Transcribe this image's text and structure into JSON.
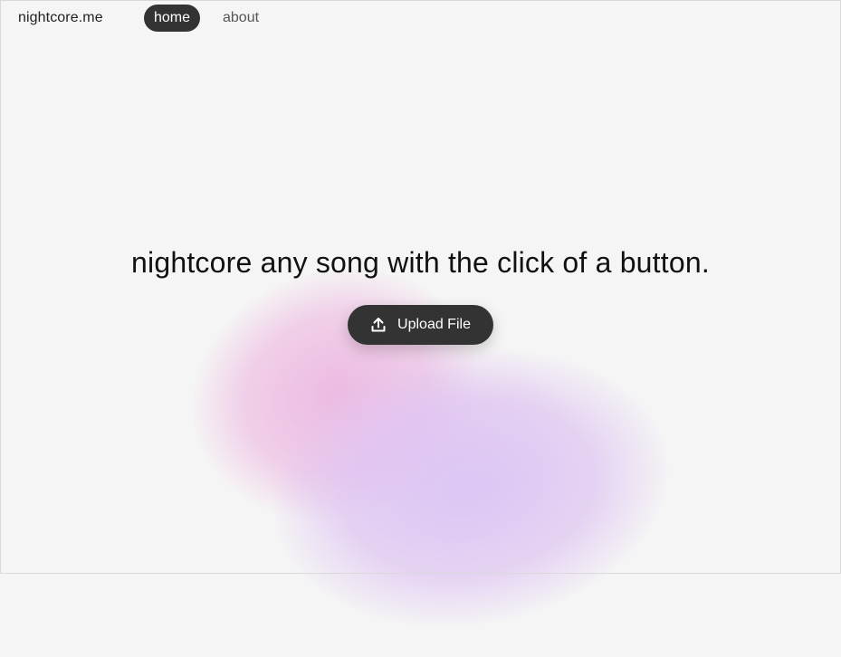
{
  "nav": {
    "brand": "nightcore.me",
    "items": [
      {
        "label": "home",
        "active": true
      },
      {
        "label": "about",
        "active": false
      }
    ]
  },
  "hero": {
    "headline": "nightcore any song with the click of a button.",
    "upload_button": {
      "label": "Upload File",
      "icon": "upload-icon"
    }
  },
  "colors": {
    "background": "#f5f5f5",
    "button_dark": "#333333",
    "button_text": "#ffffff",
    "blob_pink": "#ecb0de",
    "blob_purple": "#dac4f4"
  }
}
